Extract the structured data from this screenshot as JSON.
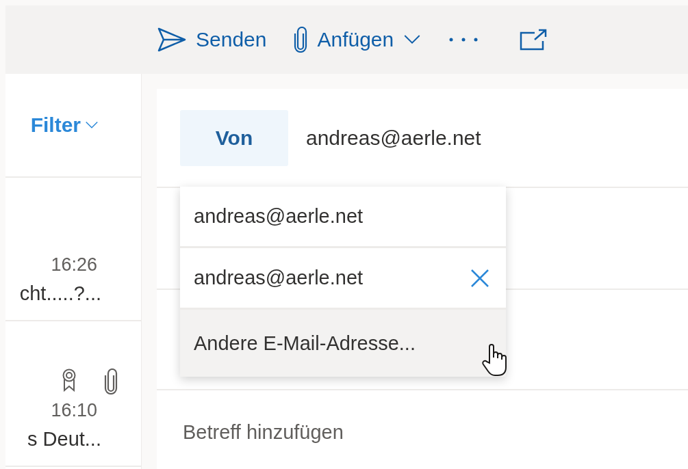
{
  "toolbar": {
    "buttons": [
      {
        "kind": "send",
        "label": "Senden"
      },
      {
        "kind": "attach",
        "label": "Anfügen"
      },
      {
        "kind": "more"
      },
      {
        "kind": "popout"
      }
    ]
  },
  "message_list": {
    "filter": {
      "label": "Filter"
    },
    "messages": [
      {
        "time": "16:26",
        "preview": "cht.....?..."
      },
      {
        "time": "16:10",
        "preview": "s Deut...",
        "icons": [
          {
            "kind": "award"
          },
          {
            "kind": "attachment"
          }
        ]
      }
    ]
  },
  "compose": {
    "from_label": "Von",
    "from_value": "andreas@aerle.net",
    "from_menu": [
      {
        "label": "andreas@aerle.net",
        "removable": false,
        "hovered": false
      },
      {
        "label": "andreas@aerle.net",
        "removable": true,
        "hovered": false
      },
      {
        "label": "Andere E-Mail-Adresse...",
        "removable": false,
        "hovered": true
      }
    ],
    "subject": {
      "placeholder": "Betreff hinzufügen"
    }
  }
}
